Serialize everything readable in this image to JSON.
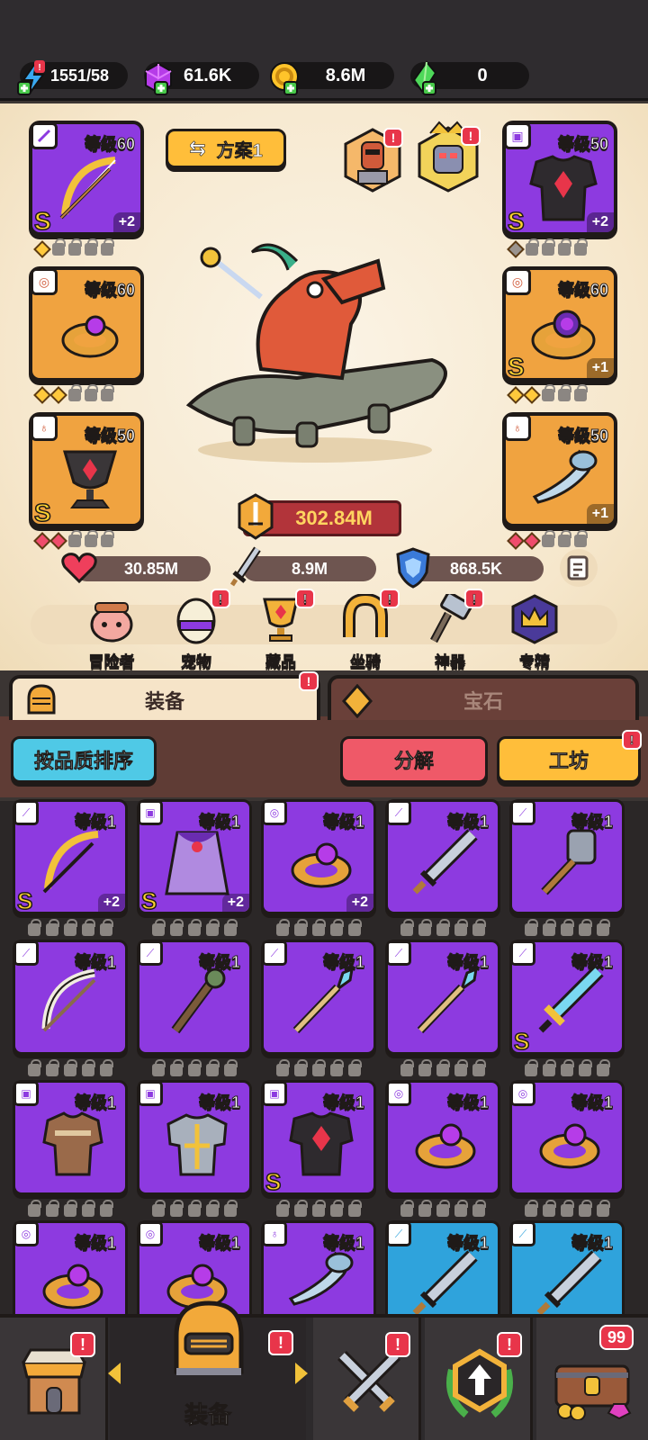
{
  "resources": [
    {
      "icon": "energy-icon",
      "value": "1551/58"
    },
    {
      "icon": "purple-gem-icon",
      "value": "61.6K"
    },
    {
      "icon": "gold-coin-icon",
      "value": "8.6M"
    },
    {
      "icon": "green-crystal-icon",
      "value": "0"
    }
  ],
  "loadout": {
    "label": "方案1"
  },
  "equipped": {
    "left": [
      {
        "type": "weapon",
        "level": "等级60",
        "rarity": "S",
        "plus": "+2"
      },
      {
        "type": "ring",
        "level": "等级60",
        "rarity": "",
        "plus": ""
      },
      {
        "type": "necklace",
        "level": "等级50",
        "rarity": "S",
        "plus": ""
      }
    ],
    "right": [
      {
        "type": "armor",
        "level": "等级50",
        "rarity": "S",
        "plus": "+2"
      },
      {
        "type": "ring",
        "level": "等级60",
        "rarity": "S",
        "plus": "+1"
      },
      {
        "type": "necklace",
        "level": "等级50",
        "rarity": "",
        "plus": "+1"
      }
    ]
  },
  "power": "302.84M",
  "stats": {
    "hp": "30.85M",
    "attack": "8.9M",
    "defense": "868.5K"
  },
  "nav": [
    {
      "label": "冒险者",
      "icon": "adventurer-icon",
      "badge": false
    },
    {
      "label": "宠物",
      "icon": "pet-egg-icon",
      "badge": true
    },
    {
      "label": "藏品",
      "icon": "collection-trophy-icon",
      "badge": true
    },
    {
      "label": "坐骑",
      "icon": "mount-horseshoe-icon",
      "badge": true
    },
    {
      "label": "神器",
      "icon": "artifact-hammer-icon",
      "badge": true
    },
    {
      "label": "专精",
      "icon": "mastery-crown-icon",
      "badge": false
    }
  ],
  "tabs": {
    "equipment": "装备",
    "gems": "宝石"
  },
  "buttons": {
    "sort": "按品质排序",
    "dismantle": "分解",
    "workshop": "工坊"
  },
  "inventory": [
    {
      "type": "weapon",
      "level": "等级1",
      "rarity": "S",
      "plus": "+2",
      "color": "purple",
      "item": "bow"
    },
    {
      "type": "armor",
      "level": "等级1",
      "rarity": "S",
      "plus": "+2",
      "color": "purple",
      "item": "cape"
    },
    {
      "type": "ring",
      "level": "等级1",
      "rarity": "",
      "plus": "+2",
      "color": "purple",
      "item": "ring"
    },
    {
      "type": "weapon",
      "level": "等级1",
      "rarity": "",
      "plus": "",
      "color": "purple",
      "item": "sword"
    },
    {
      "type": "weapon",
      "level": "等级1",
      "rarity": "",
      "plus": "",
      "color": "purple",
      "item": "hammer"
    },
    {
      "type": "weapon",
      "level": "等级1",
      "rarity": "",
      "plus": "",
      "color": "purple",
      "item": "bone-bow"
    },
    {
      "type": "weapon",
      "level": "等级1",
      "rarity": "",
      "plus": "",
      "color": "purple",
      "item": "staff"
    },
    {
      "type": "weapon",
      "level": "等级1",
      "rarity": "",
      "plus": "",
      "color": "purple",
      "item": "spear"
    },
    {
      "type": "weapon",
      "level": "等级1",
      "rarity": "",
      "plus": "",
      "color": "purple",
      "item": "spear"
    },
    {
      "type": "weapon",
      "level": "等级1",
      "rarity": "S",
      "plus": "",
      "color": "purple",
      "item": "crystal-sword"
    },
    {
      "type": "armor",
      "level": "等级1",
      "rarity": "",
      "plus": "",
      "color": "purple",
      "item": "leather-armor"
    },
    {
      "type": "armor",
      "level": "等级1",
      "rarity": "",
      "plus": "",
      "color": "purple",
      "item": "plate-armor"
    },
    {
      "type": "armor",
      "level": "等级1",
      "rarity": "S",
      "plus": "",
      "color": "purple",
      "item": "dark-armor"
    },
    {
      "type": "ring",
      "level": "等级1",
      "rarity": "",
      "plus": "",
      "color": "purple",
      "item": "ring"
    },
    {
      "type": "ring",
      "level": "等级1",
      "rarity": "",
      "plus": "",
      "color": "purple",
      "item": "ring"
    },
    {
      "type": "ring",
      "level": "等级1",
      "rarity": "",
      "plus": "",
      "color": "purple",
      "item": "ring"
    },
    {
      "type": "ring",
      "level": "等级1",
      "rarity": "",
      "plus": "",
      "color": "purple",
      "item": "ring"
    },
    {
      "type": "necklace",
      "level": "等级1",
      "rarity": "",
      "plus": "",
      "color": "purple",
      "item": "horn"
    },
    {
      "type": "weapon",
      "level": "等级1",
      "rarity": "",
      "plus": "",
      "color": "blue",
      "item": "sword"
    },
    {
      "type": "weapon",
      "level": "等级1",
      "rarity": "",
      "plus": "",
      "color": "blue",
      "item": "sword"
    }
  ],
  "bottom_nav": {
    "shop": {
      "icon": "shop-icon",
      "badge": "!"
    },
    "equipment": {
      "icon": "helmet-icon",
      "label": "装备",
      "badge": "!"
    },
    "battle": {
      "icon": "crossed-swords-icon",
      "badge": "!"
    },
    "upgrade": {
      "icon": "upgrade-arrow-icon",
      "badge": "!"
    },
    "chest": {
      "icon": "treasure-chest-icon",
      "count": "99"
    }
  }
}
